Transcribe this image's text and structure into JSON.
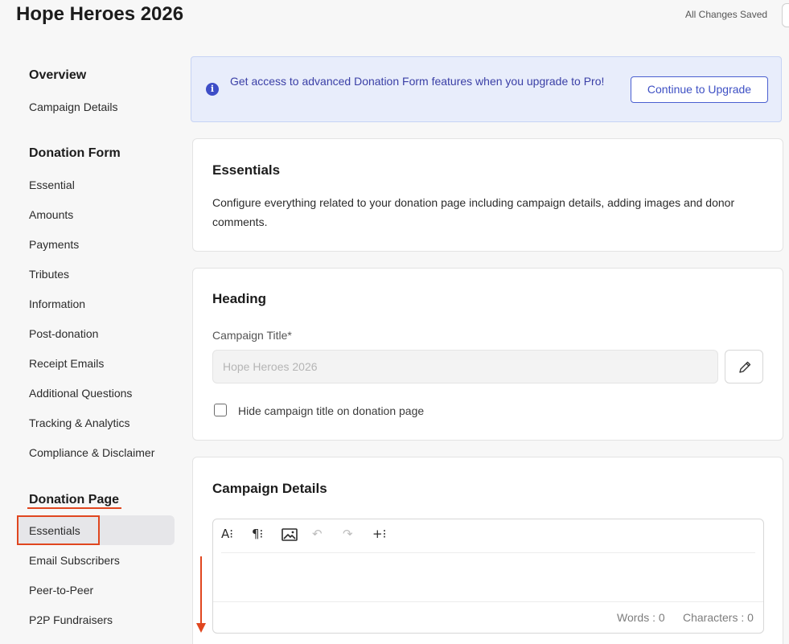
{
  "header": {
    "title": "Hope Heroes 2026",
    "status": "All Changes Saved"
  },
  "sidebar": {
    "sections": [
      {
        "title": "Overview",
        "items": [
          "Campaign Details"
        ]
      },
      {
        "title": "Donation Form",
        "items": [
          "Essential",
          "Amounts",
          "Payments",
          "Tributes",
          "Information",
          "Post-donation",
          "Receipt Emails",
          "Additional Questions",
          "Tracking & Analytics",
          "Compliance & Disclaimer"
        ]
      },
      {
        "title": "Donation Page",
        "items": [
          "Essentials",
          "Email Subscribers",
          "Peer-to-Peer",
          "P2P Fundraisers"
        ]
      }
    ],
    "active_item": "Essentials"
  },
  "banner": {
    "icon": "info-icon",
    "icon_glyph": "i",
    "text": "Get access to advanced Donation Form features when you upgrade to Pro!",
    "button": "Continue to Upgrade"
  },
  "essentials_card": {
    "title": "Essentials",
    "description": "Configure everything related to your donation page including campaign details, adding images and donor comments."
  },
  "heading_card": {
    "title": "Heading",
    "field_label": "Campaign Title*",
    "field_value": "Hope Heroes 2026",
    "edit_icon": "pencil-icon",
    "checkbox_label": "Hide campaign title on donation page",
    "checkbox_checked": false
  },
  "details_card": {
    "title": "Campaign Details",
    "toolbar": [
      {
        "name": "text-style-icon",
        "glyph": "A⁝"
      },
      {
        "name": "paragraph-icon",
        "glyph": "¶⁝"
      },
      {
        "name": "image-icon",
        "glyph": ""
      },
      {
        "name": "undo-icon",
        "glyph": "↶"
      },
      {
        "name": "redo-icon",
        "glyph": "↷"
      },
      {
        "name": "insert-icon",
        "glyph": "+⁝"
      }
    ],
    "words": "Words : 0",
    "characters": "Characters : 0"
  },
  "colors": {
    "accent": "#3e50c4",
    "annotation": "#e0461f",
    "banner_bg": "#e8edfb"
  }
}
